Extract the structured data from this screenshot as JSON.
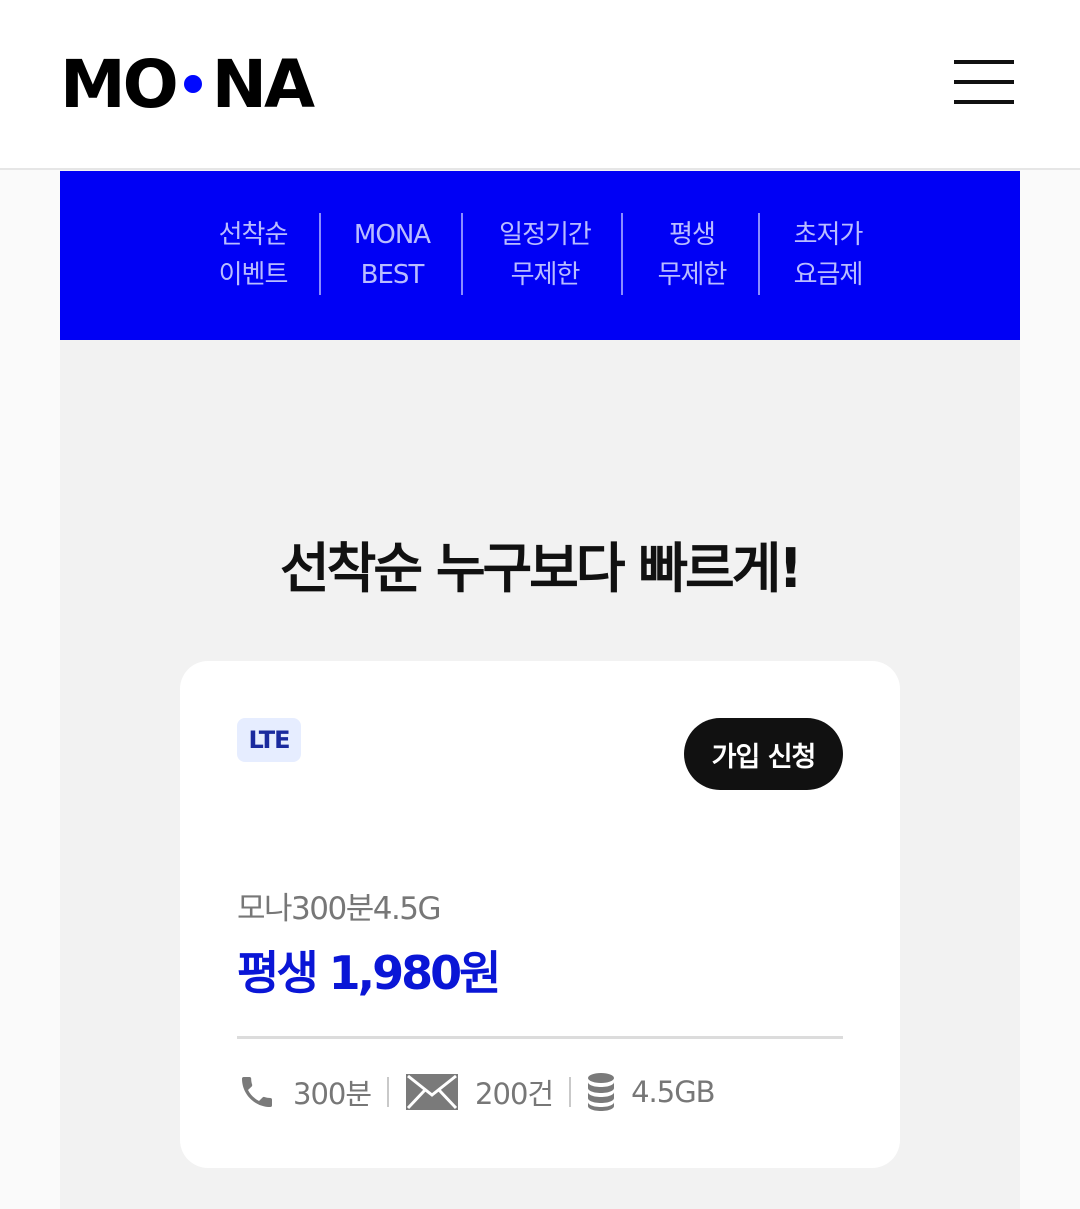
{
  "header": {
    "logo_left": "MO",
    "logo_right": "NA",
    "accent_color": "#0008ff"
  },
  "nav": {
    "background": "#0000f5",
    "items": [
      {
        "line1": "선착순",
        "line2": "이벤트"
      },
      {
        "line1": "MONA",
        "line2": "BEST"
      },
      {
        "line1": "일정기간",
        "line2": "무제한"
      },
      {
        "line1": "평생",
        "line2": "무제한"
      },
      {
        "line1": "초저가",
        "line2": "요금제"
      }
    ]
  },
  "main": {
    "headline": "선착순 누구보다 빠르게!"
  },
  "plan_card": {
    "badge": "LTE",
    "apply_label": "가입 신청",
    "plan_name": "모나300분4.5G",
    "price": "평생 1,980원",
    "specs": {
      "voice": "300분",
      "sms": "200건",
      "data": "4.5GB"
    },
    "icons": [
      "phone-icon",
      "envelope-icon",
      "database-icon"
    ]
  }
}
